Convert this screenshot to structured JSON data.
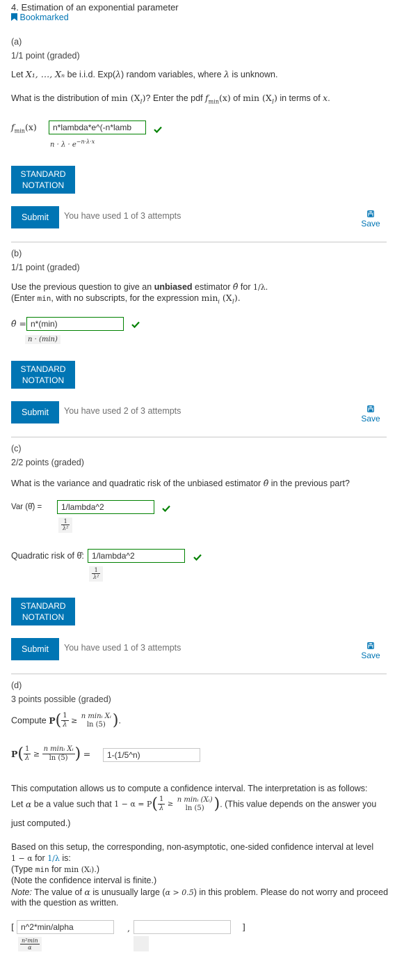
{
  "header": {
    "title": "4. Estimation of an exponential parameter",
    "bookmark_label": "Bookmarked"
  },
  "part_a": {
    "label": "(a)",
    "points": "1/1 point (graded)",
    "intro": {
      "pre": "Let ",
      "vars": "X₁, …, Xₙ",
      "mid": " be i.i.d. Exp(",
      "lambda": "λ",
      "post": ") random variables, where ",
      "lambda2": "λ",
      "end": " is unknown."
    },
    "question": {
      "pre": "What is the distribution of ",
      "min1": "min (X",
      "sub1": "I",
      "close1": ")",
      "mid": "? Enter the pdf ",
      "f": "f",
      "fsub": "min",
      "fx": "(x)",
      "mid2": " of ",
      "min2": "min (X",
      "sub2": "I",
      "close2": ")",
      "end": " in terms of ",
      "x": "x",
      "period": "."
    },
    "answer_label_f": "f",
    "answer_label_sub": "min",
    "answer_label_x": "(x)",
    "input_value": "n*lambda*e^(-n*lamb",
    "preview": "n · λ · e",
    "preview_sup": "−n·λ·x",
    "standard_notation": [
      "STANDARD",
      "NOTATION"
    ],
    "submit": "Submit",
    "attempts": "You have used 1 of 3 attempts",
    "save": "Save"
  },
  "part_b": {
    "label": "(b)",
    "points": "1/1 point (graded)",
    "line1_pre": "Use the previous question to give an ",
    "line1_bold": "unbiased",
    "line1_mid": " estimator ",
    "line1_theta": "θ̂",
    "line1_for": " for ",
    "line1_frac": "1/λ",
    "line1_end": ".",
    "line2_pre": "(Enter ",
    "line2_code": "min",
    "line2_mid": ", with no subscripts, for the expression ",
    "line2_expr": "min",
    "line2_sub": "i",
    "line2_x": " (X",
    "line2_xsub": "I",
    "line2_end": ").",
    "answer_label": "θ̂ =",
    "input_value": "n*(min)",
    "preview": "n · (min)",
    "standard_notation": [
      "STANDARD",
      "NOTATION"
    ],
    "submit": "Submit",
    "attempts": "You have used 2 of 3 attempts",
    "save": "Save"
  },
  "part_c": {
    "label": "(c)",
    "points": "2/2 points (graded)",
    "question_pre": "What is the variance and quadratic risk of the unbiased estimator ",
    "question_theta": "θ̂",
    "question_end": " in the previous part?",
    "var_label": "Var (θ̂) =",
    "var_input": "1/lambda^2",
    "var_preview_num": "1",
    "var_preview_den": "λ²",
    "risk_label": "Quadratic risk of θ̂:",
    "risk_input": "1/lambda^2",
    "risk_preview_num": "1",
    "risk_preview_den": "λ²",
    "standard_notation": [
      "STANDARD",
      "NOTATION"
    ],
    "submit": "Submit",
    "attempts": "You have used 1 of 3 attempts",
    "save": "Save"
  },
  "part_d": {
    "label": "(d)",
    "points": "3 points possible (graded)",
    "compute_label": "Compute",
    "prob_P": "P",
    "one": "1",
    "lambda": "λ",
    "geq": "≥",
    "num_expr": "n minᵢ Xᵢ",
    "den_expr": "ln (5)",
    "eq": "=",
    "answer_value": "1-(1/5^n)",
    "interp_line1": "This computation allows us to compute a confidence interval. The interpretation is as follows:",
    "interp_let": "Let ",
    "interp_alpha": "α",
    "interp_mid": " be a value such that ",
    "interp_expr": "1 − α = P",
    "interp_num2": "n minᵢ (Xᵢ)",
    "interp_after": ". (This value depends on the answer you",
    "interp_line3": "just computed.)",
    "ci_line1": "Based on this setup, the corresponding, non-asymptotic, one-sided confidence interval at level",
    "ci_line2_expr": "1 − α",
    "ci_line2_for": " for ",
    "ci_line2_frac": "1/λ",
    "ci_line2_end": " is:",
    "ci_line3_pre": "(Type ",
    "ci_line3_code": "min",
    "ci_line3_mid": " for ",
    "ci_line3_expr": "min (Xᵢ)",
    "ci_line3_end": ".)",
    "ci_line4": "(Note the confidence interval is finite.)",
    "note_label": "Note:",
    "note_text_pre": " The value of ",
    "note_alpha": "α",
    "note_text_mid": " is unusually large (",
    "note_cond": "α > 0.5",
    "note_text_end": ") in this problem. Please do not worry and proceed",
    "note_line2": "with the question as written.",
    "bracket_open": "[",
    "comma": ",",
    "bracket_close": "]",
    "lower_input": "n^2*min/alpha",
    "upper_input": "",
    "lower_preview_num": "n²min",
    "lower_preview_den": "α"
  },
  "colors": {
    "accent": "#0075b4",
    "correct": "#008100",
    "divider": "#c8c8c8"
  }
}
